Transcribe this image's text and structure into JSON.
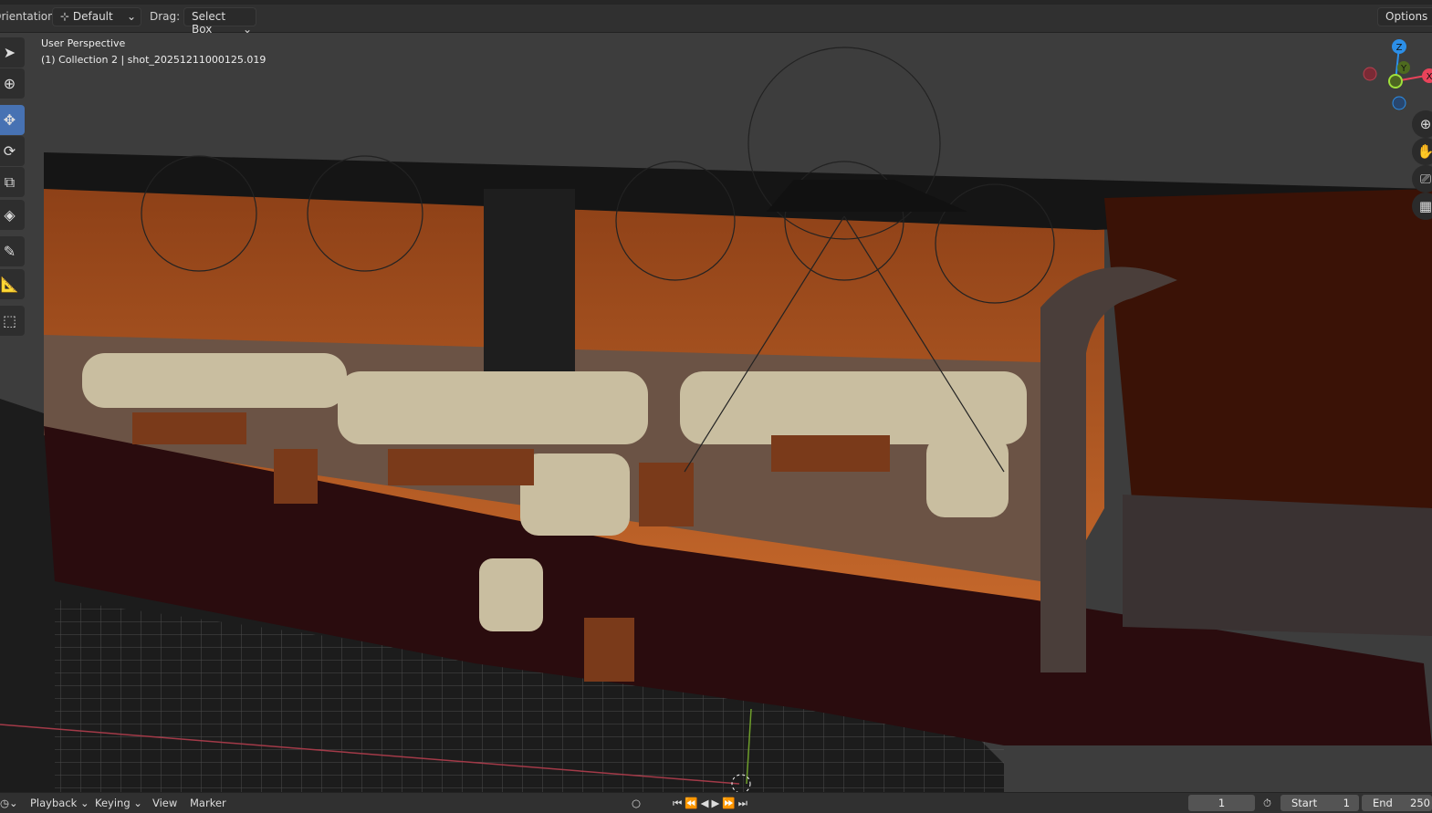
{
  "header": {
    "orientation_label": "Orientation:",
    "orientation_value": "Default",
    "drag_label": "Drag:",
    "drag_value": "Select Box",
    "options_label": "Options"
  },
  "viewport": {
    "view_name": "User Perspective",
    "collection_info": "(1) Collection 2 | shot_20251211000125.019"
  },
  "gizmo": {
    "z": "Z",
    "y": "Y",
    "x": "X"
  },
  "toolbar": [
    "select-box",
    "cursor",
    "move",
    "rotate",
    "scale",
    "transform",
    "annotate",
    "measure",
    "add-cube"
  ],
  "timeline": {
    "playback": "Playback",
    "keying": "Keying",
    "view": "View",
    "marker": "Marker",
    "current_frame": "1",
    "start_label": "Start",
    "start_value": "1",
    "end_label": "End",
    "end_value": "250"
  },
  "colors": {
    "accent": "#4772b3",
    "x_axis": "#e8435a",
    "y_axis": "#8bc53f",
    "z_axis": "#2c8fe8"
  }
}
